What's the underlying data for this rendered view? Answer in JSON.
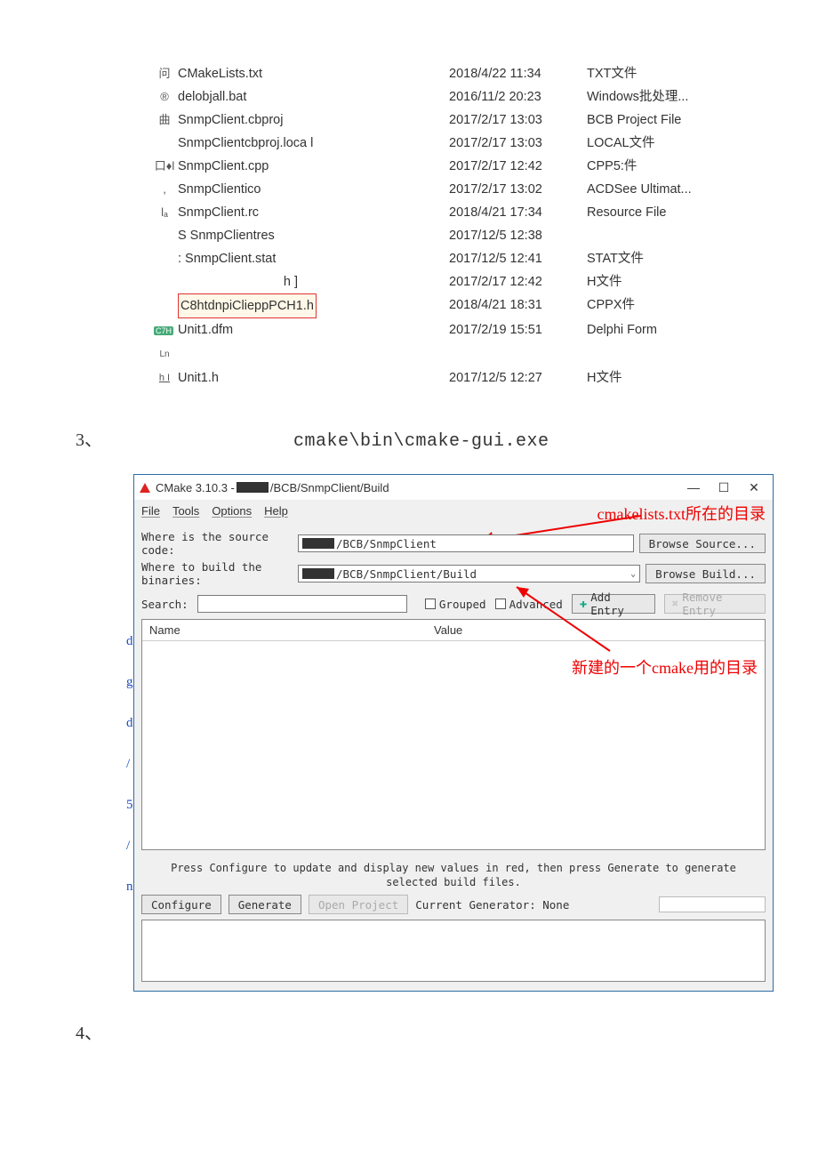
{
  "file_list": [
    {
      "icon": "问",
      "name": "CMakeLists.txt",
      "date": "2018/4/22 11:34",
      "type": "TXT文件"
    },
    {
      "icon": "®",
      "name": "delobjall.bat",
      "date": "2016/11/2 20:23",
      "type": "Windows批处理..."
    },
    {
      "icon": "曲",
      "name": "SnmpClient.cbproj",
      "date": "2017/2/17 13:03",
      "type": "BCB Project File"
    },
    {
      "icon": "",
      "name": "SnmpClientcbproj.loca l",
      "date": "2017/2/17 13:03",
      "type": "LOCAL文件"
    },
    {
      "icon": "口♦l",
      "name": "SnmpClient.cpp",
      "date": "2017/2/17 12:42",
      "type": "CPP5:件"
    },
    {
      "icon": ",",
      "name": "SnmpClientico",
      "date": "2017/2/17 13:02",
      "type": "ACDSee Ultimat..."
    },
    {
      "icon": "lₐ",
      "name": "SnmpClient.rc",
      "date": "2018/4/21 17:34",
      "type": "Resource File"
    },
    {
      "icon": "S",
      "name": "SnmpClientres",
      "date": "2017/12/5 12:38",
      "type": ""
    },
    {
      "icon": ":",
      "name": "SnmpClient.stat",
      "date": "2017/12/5 12:41",
      "type": "STAT文件"
    },
    {
      "icon": "",
      "name": "h ]",
      "date": "2017/2/17 12:42",
      "type": "H文件",
      "right": true
    },
    {
      "icon": "",
      "name": "",
      "date": "2018/4/21 18:31",
      "type": "CPPX件",
      "special": "pch"
    },
    {
      "icon": "",
      "name": "Unit1.dfm",
      "date": "2017/2/19 15:51",
      "type": "Delphi Form",
      "special": "ln"
    },
    {
      "icon": "h I",
      "name": "Unit1.h",
      "date": "2017/12/5 12:27",
      "type": "H文件",
      "u": true
    }
  ],
  "pch_label": "C8htdnpiClieppPCH1.h",
  "step3": {
    "num": "3、",
    "path": "cmake\\bin\\cmake-gui.exe"
  },
  "cmake": {
    "title_prefix": "CMake 3.10.3 -",
    "title_suffix": "/BCB/SnmpClient/Build",
    "menu": [
      "File",
      "Tools",
      "Options",
      "Help"
    ],
    "src_label": "Where is the source code:",
    "src_value": "/BCB/SnmpClient",
    "bin_label": "Where to build the binaries:",
    "bin_value": "/BCB/SnmpClient/Build",
    "browse_src": "Browse Source...",
    "browse_bld": "Browse Build...",
    "search": "Search:",
    "grouped": "Grouped",
    "advanced": "Advanced",
    "add_entry": "Add Entry",
    "remove_entry": "Remove Entry",
    "grid_name": "Name",
    "grid_value": "Value",
    "instr": "Press Configure to update and display new values in red, then press Generate to generate selected build files.",
    "configure": "Configure",
    "generate": "Generate",
    "open_proj": "Open Project",
    "cur_gen": "Current Generator: None"
  },
  "annot1": "cmakelists.txt所在的目录",
  "annot2": "新建的一个cmake用的目录",
  "step4": "4、",
  "left_strip": [
    "d",
    "g",
    "d",
    "/",
    "5",
    "/",
    "",
    "n"
  ]
}
